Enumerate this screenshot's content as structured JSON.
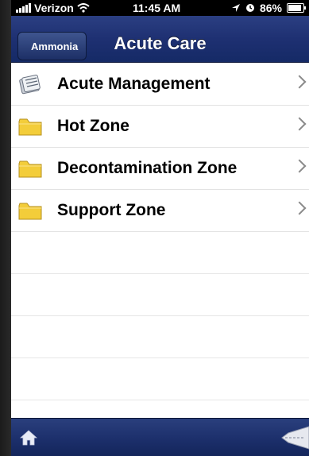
{
  "status_bar": {
    "carrier": "Verizon",
    "time": "11:45 AM",
    "battery": "86%"
  },
  "nav": {
    "back_label": "Ammonia",
    "title": "Acute Care"
  },
  "list": {
    "items": [
      {
        "label": "Acute Management",
        "icon": "document-icon"
      },
      {
        "label": "Hot Zone",
        "icon": "folder-icon"
      },
      {
        "label": "Decontamination Zone",
        "icon": "folder-icon"
      },
      {
        "label": "Support Zone",
        "icon": "folder-icon"
      }
    ]
  },
  "toolbar": {
    "home_icon": "home-icon",
    "right_icon": "slider-icon"
  },
  "colors": {
    "nav_bar": "#1e3072",
    "toolbar": "#1c2f6b",
    "folder": "#f3cd3a"
  }
}
